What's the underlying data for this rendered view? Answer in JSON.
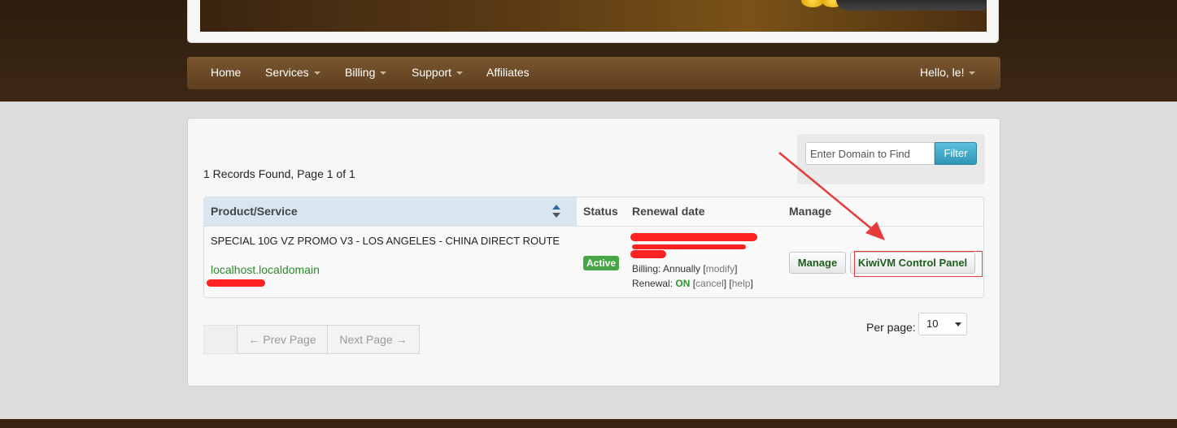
{
  "nav": {
    "items": [
      {
        "label": "Home",
        "dropdown": false
      },
      {
        "label": "Services",
        "dropdown": true
      },
      {
        "label": "Billing",
        "dropdown": true
      },
      {
        "label": "Support",
        "dropdown": true
      },
      {
        "label": "Affiliates",
        "dropdown": false
      }
    ],
    "user": "Hello, le!"
  },
  "records_text": "1 Records Found, Page 1 of 1",
  "filter": {
    "placeholder": "Enter Domain to Find",
    "button": "Filter"
  },
  "table": {
    "headers": [
      "Product/Service",
      "Status",
      "Renewal date",
      "Manage"
    ],
    "row": {
      "product": "SPECIAL 10G VZ PROMO V3 - LOS ANGELES - CHINA DIRECT ROUTE",
      "domain": "localhost.localdomain",
      "status": "Active",
      "billing_label": "Billing: Annually",
      "billing_link": "modify",
      "renewal_label": "Renewal:",
      "renewal_value": "ON",
      "cancel_link": "cancel",
      "help_link": "help",
      "manage_button": "Manage",
      "kiwivm_button": "KiwiVM Control Panel"
    }
  },
  "pager": {
    "prev": "← Prev Page",
    "next": "Next Page →"
  },
  "per_page": {
    "label": "Per page:",
    "value": "10"
  },
  "colors": {
    "nav_bg": "#6b4a28",
    "active_badge": "#46a546",
    "filter_btn": "#3fa8cc",
    "annotation": "#e53b3b"
  }
}
